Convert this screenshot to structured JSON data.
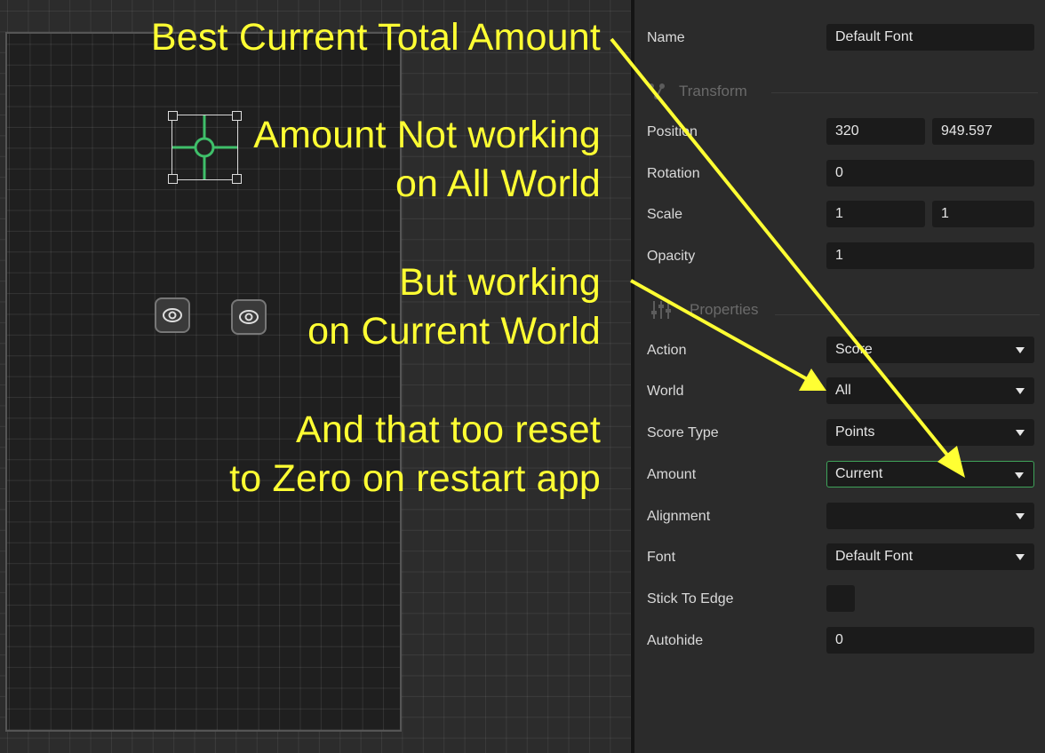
{
  "inspector": {
    "name": {
      "label": "Name",
      "value": "Default Font"
    },
    "sections": {
      "transform": "Transform",
      "properties": "Properties"
    },
    "position": {
      "label": "Position",
      "x": "320",
      "y": "949.597"
    },
    "rotation": {
      "label": "Rotation",
      "value": "0"
    },
    "scale": {
      "label": "Scale",
      "x": "1",
      "y": "1"
    },
    "opacity": {
      "label": "Opacity",
      "value": "1"
    },
    "action": {
      "label": "Action",
      "value": "Score"
    },
    "world": {
      "label": "World",
      "value": "All"
    },
    "score_type": {
      "label": "Score Type",
      "value": "Points"
    },
    "amount": {
      "label": "Amount",
      "value": "Current"
    },
    "alignment": {
      "label": "Alignment",
      "value": ""
    },
    "font": {
      "label": "Font",
      "value": "Default Font"
    },
    "stick_to_edge": {
      "label": "Stick To Edge",
      "checked": false
    },
    "autohide": {
      "label": "Autohide",
      "value": "0"
    }
  },
  "annotations": {
    "line1": "Best Current Total Amount",
    "line2a": "Amount Not working",
    "line2b": "on All World",
    "line3a": "But working",
    "line3b": "on Current World",
    "line4a": "And that too reset",
    "line4b": "to Zero on restart app"
  },
  "colors": {
    "annotation": "#ffff33",
    "selection_handle": "#3fbf6a",
    "panel_bg": "#2b2b2b",
    "field_bg": "#1b1b1b"
  },
  "icons": {
    "transform_section": "transform-icon",
    "properties_section": "sliders-icon",
    "canvas_nodes": "eye-icon"
  }
}
